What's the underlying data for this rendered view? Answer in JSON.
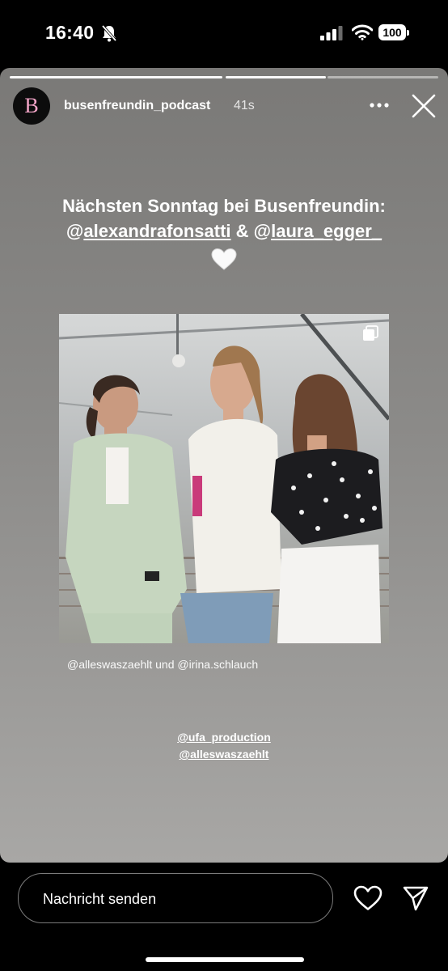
{
  "status_bar": {
    "time": "16:40",
    "battery": "100",
    "icons": [
      "bell-slash-icon",
      "cellular-signal-icon",
      "wifi-icon",
      "battery-icon"
    ]
  },
  "story": {
    "username": "busenfreundin_podcast",
    "time_ago": "41s",
    "avatar_letter": "B",
    "segments": [
      {
        "state": "viewed"
      },
      {
        "state": "current"
      },
      {
        "state": "upcoming"
      }
    ],
    "headline": {
      "line1": "Nächsten Sonntag bei Busenfreundin:",
      "at1": "@",
      "mention1": "alexandrafonsatti",
      "amp": " & @",
      "mention2": "laura_egger_"
    },
    "heart_emoji": "white-heart",
    "post": {
      "tags_text": "@alleswaszaehlt und @irina.schlauch"
    },
    "credits": [
      "@ufa_production",
      "@alleswaszaehlt"
    ]
  },
  "footer": {
    "message_placeholder": "Nachricht senden"
  },
  "colors": {
    "avatar_letter": "#f4a5c8",
    "story_top": "#7a7977",
    "story_bottom": "#a8a7a5"
  }
}
